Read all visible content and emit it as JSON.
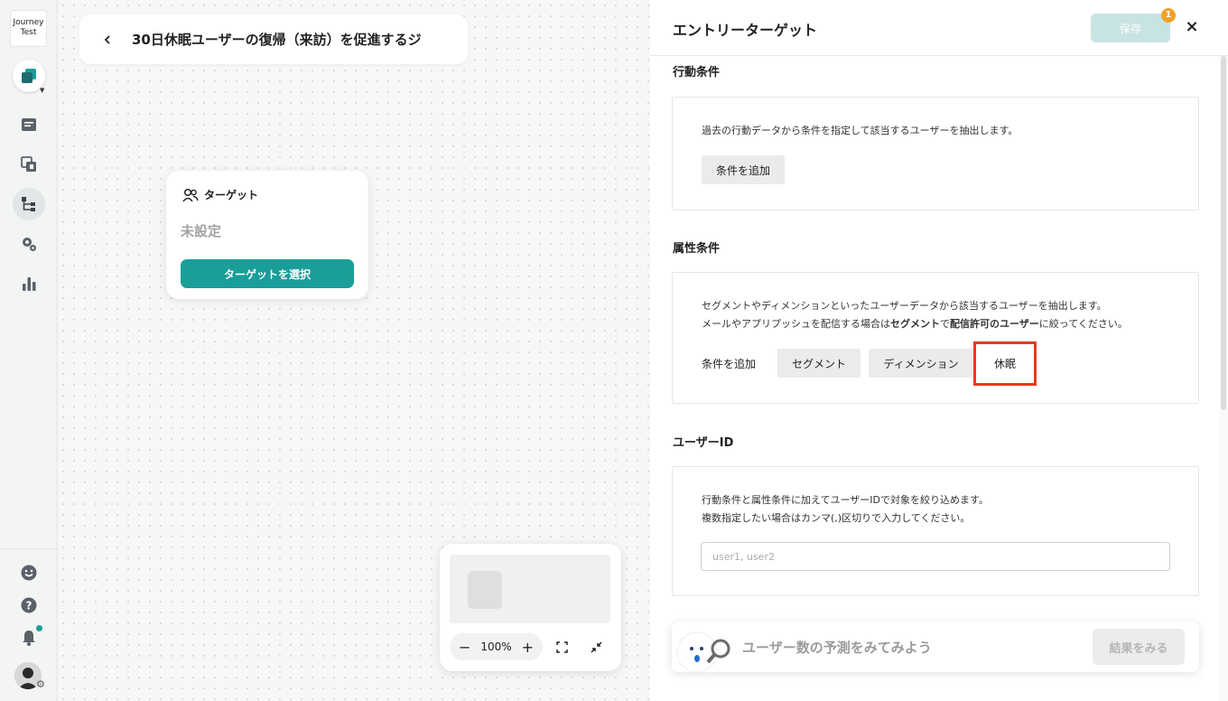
{
  "sidebar": {
    "logo_line1": "Journey",
    "logo_line2": "Test"
  },
  "canvas": {
    "title": "30日休眠ユーザーの復帰（来訪）を促進するジ",
    "target_card": {
      "heading": "ターゲット",
      "status": "未設定",
      "button": "ターゲットを選択"
    },
    "zoom": {
      "minus": "−",
      "level": "100%",
      "plus": "+"
    }
  },
  "panel": {
    "title": "エントリーターゲット",
    "save_label": "保存",
    "save_badge": "1",
    "close": "×",
    "behavior": {
      "title": "行動条件",
      "desc": "過去の行動データから条件を指定して該当するユーザーを抽出します。",
      "add_button": "条件を追加"
    },
    "attribute": {
      "title": "属性条件",
      "desc1": "セグメントやディメンションといったユーザーデータから該当するユーザーを抽出します。",
      "desc2_pre": "メールやアプリプッシュを配信する場合は",
      "desc2_bold1": "セグメント",
      "desc2_mid": "で",
      "desc2_bold2": "配信許可のユーザー",
      "desc2_post": "に絞ってください。",
      "add_label": "条件を追加",
      "buttons": [
        "セグメント",
        "ディメンション",
        "休眠"
      ]
    },
    "user_id": {
      "title": "ユーザーID",
      "desc1": "行動条件と属性条件に加えてユーザーIDで対象を絞り込めます。",
      "desc2": "複数指定したい場合はカンマ(,)区切りで入力してください。",
      "placeholder": "user1, user2"
    },
    "predict": {
      "text": "ユーザー数の予測をみてみよう",
      "button": "結果をみる"
    }
  },
  "colors": {
    "accent": "#1a9e9a",
    "save_disabled": "#c7e3e2",
    "badge": "#f0a12a",
    "highlight": "#e8391c"
  }
}
